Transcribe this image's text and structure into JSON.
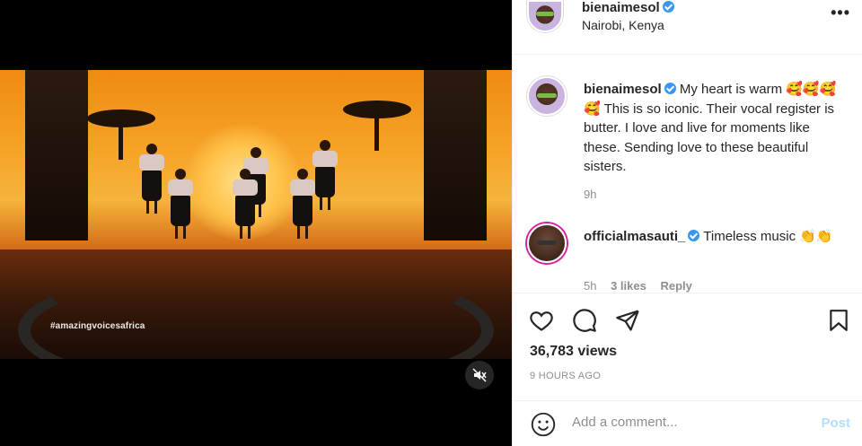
{
  "video": {
    "hashtag": "#amazingvoicesafrica",
    "mute_icon": "speaker-muted-icon"
  },
  "header": {
    "username": "bienaimesol",
    "location": "Nairobi, Kenya",
    "more_label": "•••"
  },
  "caption": {
    "username": "bienaimesol",
    "text": "My heart is warm 🥰🥰🥰🥰 This is so iconic. Their vocal register is butter. I love and live for moments like these. Sending love to these beautiful sisters.",
    "time": "9h"
  },
  "comment1": {
    "username": "officialmasauti_",
    "text": "Timeless music 👏👏",
    "time": "5h",
    "likes": "3 likes",
    "reply": "Reply"
  },
  "actions": {
    "views": "36,783 views",
    "timestamp": "9 HOURS AGO"
  },
  "add_comment": {
    "placeholder": "Add a comment...",
    "post_label": "Post"
  },
  "colors": {
    "verified": "#3897f0",
    "muted_text": "#8e8e8e",
    "post_disabled": "#b2dffc"
  }
}
